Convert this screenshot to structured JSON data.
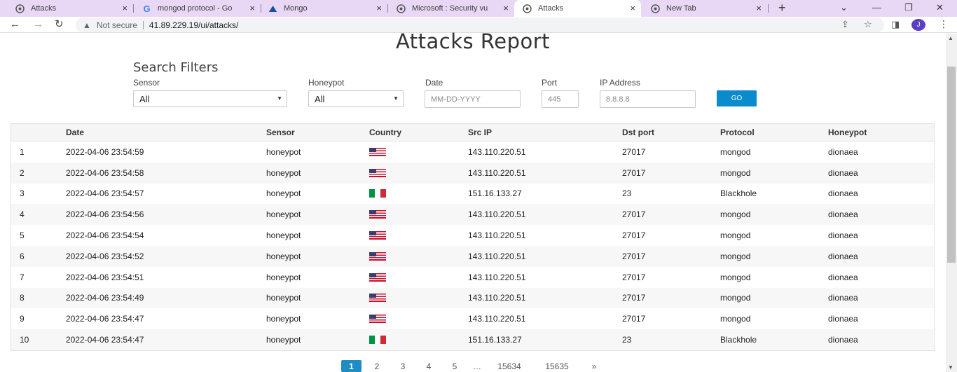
{
  "browser": {
    "tabs": [
      {
        "title": "Attacks",
        "close": "×",
        "active": false
      },
      {
        "title": "mongod protocol - Go",
        "close": "×",
        "active": false
      },
      {
        "title": "Mongo",
        "close": "×",
        "active": false
      },
      {
        "title": "Microsoft : Security vu",
        "close": "×",
        "active": false
      },
      {
        "title": "Attacks",
        "close": "×",
        "active": true
      },
      {
        "title": "New Tab",
        "close": "×",
        "active": false
      }
    ],
    "new_tab": "+",
    "security_label": "Not secure",
    "url": "41.89.229.19/ui/attacks/",
    "profile_initial": "J"
  },
  "page": {
    "title": "Attacks Report",
    "filters": {
      "heading": "Search Filters",
      "sensor_label": "Sensor",
      "sensor_value": "All",
      "honeypot_label": "Honeypot",
      "honeypot_value": "All",
      "date_label": "Date",
      "date_placeholder": "MM-DD-YYYY",
      "port_label": "Port",
      "port_placeholder": "445",
      "ip_label": "IP Address",
      "ip_placeholder": "8.8.8.8",
      "go_label": "GO"
    },
    "table": {
      "headers": [
        "",
        "Date",
        "Sensor",
        "Country",
        "Src IP",
        "Dst port",
        "Protocol",
        "Honeypot"
      ],
      "rows": [
        {
          "n": "1",
          "date": "2022-04-06 23:54:59",
          "sensor": "honeypot",
          "flag": "us",
          "src": "143.110.220.51",
          "port": "27017",
          "protocol": "mongod",
          "honeypot": "dionaea"
        },
        {
          "n": "2",
          "date": "2022-04-06 23:54:58",
          "sensor": "honeypot",
          "flag": "us",
          "src": "143.110.220.51",
          "port": "27017",
          "protocol": "mongod",
          "honeypot": "dionaea"
        },
        {
          "n": "3",
          "date": "2022-04-06 23:54:57",
          "sensor": "honeypot",
          "flag": "it",
          "src": "151.16.133.27",
          "port": "23",
          "protocol": "Blackhole",
          "honeypot": "dionaea"
        },
        {
          "n": "4",
          "date": "2022-04-06 23:54:56",
          "sensor": "honeypot",
          "flag": "us",
          "src": "143.110.220.51",
          "port": "27017",
          "protocol": "mongod",
          "honeypot": "dionaea"
        },
        {
          "n": "5",
          "date": "2022-04-06 23:54:54",
          "sensor": "honeypot",
          "flag": "us",
          "src": "143.110.220.51",
          "port": "27017",
          "protocol": "mongod",
          "honeypot": "dionaea"
        },
        {
          "n": "6",
          "date": "2022-04-06 23:54:52",
          "sensor": "honeypot",
          "flag": "us",
          "src": "143.110.220.51",
          "port": "27017",
          "protocol": "mongod",
          "honeypot": "dionaea"
        },
        {
          "n": "7",
          "date": "2022-04-06 23:54:51",
          "sensor": "honeypot",
          "flag": "us",
          "src": "143.110.220.51",
          "port": "27017",
          "protocol": "mongod",
          "honeypot": "dionaea"
        },
        {
          "n": "8",
          "date": "2022-04-06 23:54:49",
          "sensor": "honeypot",
          "flag": "us",
          "src": "143.110.220.51",
          "port": "27017",
          "protocol": "mongod",
          "honeypot": "dionaea"
        },
        {
          "n": "9",
          "date": "2022-04-06 23:54:47",
          "sensor": "honeypot",
          "flag": "us",
          "src": "143.110.220.51",
          "port": "27017",
          "protocol": "mongod",
          "honeypot": "dionaea"
        },
        {
          "n": "10",
          "date": "2022-04-06 23:54:47",
          "sensor": "honeypot",
          "flag": "it",
          "src": "151.16.133.27",
          "port": "23",
          "protocol": "Blackhole",
          "honeypot": "dionaea"
        }
      ]
    },
    "pagination": {
      "pages": [
        "1",
        "2",
        "3",
        "4",
        "5",
        "…",
        "15634",
        "15635",
        "»"
      ],
      "current": "1"
    }
  },
  "colors": {
    "tabstrip": "#e9d8f5",
    "go_button": "#0a8ccc",
    "active_page": "#1f8dc4"
  }
}
